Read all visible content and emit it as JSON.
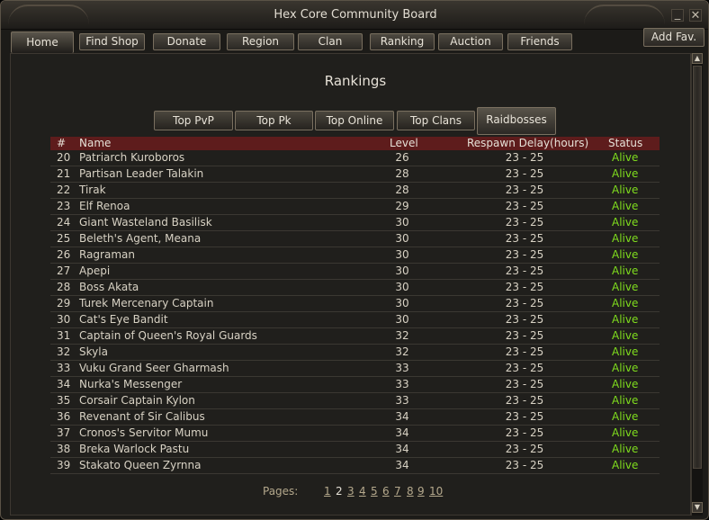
{
  "window": {
    "title": "Hex Core Community Board",
    "minimize_glyph": "_",
    "close_glyph": "✕"
  },
  "nav": {
    "tabs": [
      {
        "label": "Home",
        "active": true
      },
      {
        "label": "Find Shop"
      },
      {
        "label": "Donate"
      },
      {
        "label": "Region"
      },
      {
        "label": "Clan"
      },
      {
        "label": "Ranking"
      },
      {
        "label": "Auction"
      },
      {
        "label": "Friends"
      }
    ],
    "add_fav": "Add Fav."
  },
  "page": {
    "heading": "Rankings"
  },
  "subtabs": [
    {
      "label": "Top PvP"
    },
    {
      "label": "Top Pk"
    },
    {
      "label": "Top Online"
    },
    {
      "label": "Top Clans"
    },
    {
      "label": "Raidbosses",
      "active": true
    }
  ],
  "table": {
    "headers": {
      "num": "#",
      "name": "Name",
      "level": "Level",
      "respawn": "Respawn Delay(hours)",
      "status": "Status"
    },
    "rows": [
      {
        "num": "20",
        "name": "Patriarch Kuroboros",
        "level": "26",
        "respawn": "23 - 25",
        "status": "Alive"
      },
      {
        "num": "21",
        "name": "Partisan Leader Talakin",
        "level": "28",
        "respawn": "23 - 25",
        "status": "Alive"
      },
      {
        "num": "22",
        "name": "Tirak",
        "level": "28",
        "respawn": "23 - 25",
        "status": "Alive"
      },
      {
        "num": "23",
        "name": "Elf Renoa",
        "level": "29",
        "respawn": "23 - 25",
        "status": "Alive"
      },
      {
        "num": "24",
        "name": "Giant Wasteland Basilisk",
        "level": "30",
        "respawn": "23 - 25",
        "status": "Alive"
      },
      {
        "num": "25",
        "name": "Beleth's Agent, Meana",
        "level": "30",
        "respawn": "23 - 25",
        "status": "Alive"
      },
      {
        "num": "26",
        "name": "Ragraman",
        "level": "30",
        "respawn": "23 - 25",
        "status": "Alive"
      },
      {
        "num": "27",
        "name": "Apepi",
        "level": "30",
        "respawn": "23 - 25",
        "status": "Alive"
      },
      {
        "num": "28",
        "name": "Boss Akata",
        "level": "30",
        "respawn": "23 - 25",
        "status": "Alive"
      },
      {
        "num": "29",
        "name": "Turek Mercenary Captain",
        "level": "30",
        "respawn": "23 - 25",
        "status": "Alive"
      },
      {
        "num": "30",
        "name": "Cat's Eye Bandit",
        "level": "30",
        "respawn": "23 - 25",
        "status": "Alive"
      },
      {
        "num": "31",
        "name": "Captain of Queen's Royal Guards",
        "level": "32",
        "respawn": "23 - 25",
        "status": "Alive"
      },
      {
        "num": "32",
        "name": "Skyla",
        "level": "32",
        "respawn": "23 - 25",
        "status": "Alive"
      },
      {
        "num": "33",
        "name": "Vuku Grand Seer Gharmash",
        "level": "33",
        "respawn": "23 - 25",
        "status": "Alive"
      },
      {
        "num": "34",
        "name": "Nurka's Messenger",
        "level": "33",
        "respawn": "23 - 25",
        "status": "Alive"
      },
      {
        "num": "35",
        "name": "Corsair Captain Kylon",
        "level": "33",
        "respawn": "23 - 25",
        "status": "Alive"
      },
      {
        "num": "36",
        "name": "Revenant of Sir Calibus",
        "level": "34",
        "respawn": "23 - 25",
        "status": "Alive"
      },
      {
        "num": "37",
        "name": "Cronos's Servitor Mumu",
        "level": "34",
        "respawn": "23 - 25",
        "status": "Alive"
      },
      {
        "num": "38",
        "name": "Breka Warlock Pastu",
        "level": "34",
        "respawn": "23 - 25",
        "status": "Alive"
      },
      {
        "num": "39",
        "name": "Stakato Queen Zyrnna",
        "level": "34",
        "respawn": "23 - 25",
        "status": "Alive"
      }
    ]
  },
  "pagination": {
    "label": "Pages:",
    "pages": [
      "1",
      "2",
      "3",
      "4",
      "5",
      "6",
      "7",
      "8",
      "9",
      "10"
    ],
    "current": "2"
  },
  "colors": {
    "alive": "#7fdc1e",
    "header_bg": "#5e1c1c",
    "page_link": "#b4a88c",
    "text": "#d8d2c4"
  }
}
